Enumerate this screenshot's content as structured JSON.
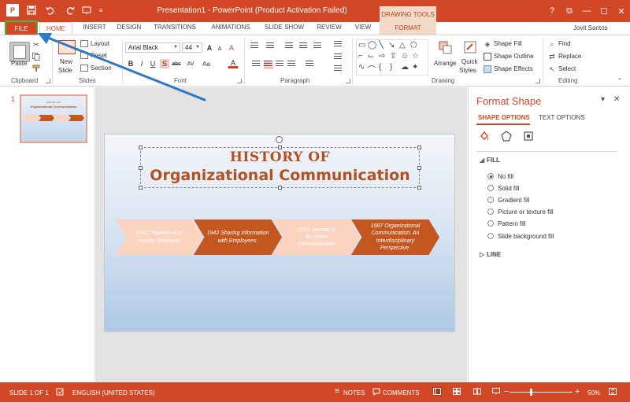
{
  "titlebar": {
    "app_icon": "P",
    "title": "Presentation1 - PowerPoint (Product Activation Failed)",
    "contextual_group": "DRAWING TOOLS",
    "qa_more": "≡",
    "window_controls": [
      "?",
      "⧉",
      "—",
      "☐",
      "✕"
    ]
  },
  "tabs": {
    "file": "FILE",
    "items": [
      "HOME",
      "INSERT",
      "DESIGN",
      "TRANSITIONS",
      "ANIMATIONS",
      "SLIDE SHOW",
      "REVIEW",
      "VIEW",
      "FORMAT"
    ],
    "user": "Jovit Santos"
  },
  "ribbon": {
    "clipboard": {
      "paste": "Paste",
      "label": "Clipboard"
    },
    "slides": {
      "new_slide": "New",
      "new_slide2": "Slide",
      "layout": "Layout",
      "reset": "Reset",
      "section": "Section",
      "label": "Slides"
    },
    "font": {
      "font_name": "Arial Black",
      "font_size": "44",
      "label": "Font",
      "bold": "B",
      "italic": "I",
      "underline": "U",
      "shadow": "S",
      "strike": "abc",
      "spacing": "AV",
      "case": "Aa",
      "color": "A",
      "grow": "A",
      "shrink": "A",
      "clear": "A"
    },
    "paragraph": {
      "label": "Paragraph"
    },
    "drawing": {
      "arrange": "Arrange",
      "quick": "Quick",
      "styles": "Styles",
      "shape_fill": "Shape Fill",
      "shape_outline": "Shape Outline",
      "shape_effects": "Shape Effects",
      "label": "Drawing"
    },
    "editing": {
      "find": "Find",
      "replace": "Replace",
      "select": "Select",
      "label": "Editing"
    }
  },
  "thumbnail": {
    "number": "1",
    "title1": "HISTORY OF",
    "title2": "Organizational Communication"
  },
  "slide": {
    "title1": "HISTORY OF",
    "title2": "Organizational Communication",
    "chevrons": [
      "1937 \"Speech and Human Relations",
      "1942 Sharing Information with Employees.",
      "1963 Journal of Business Communication",
      "1987 Organizational Communication: An Interdisciplinary Perspective."
    ]
  },
  "format_pane": {
    "title": "Format Shape",
    "tab_shape": "SHAPE OPTIONS",
    "tab_text": "TEXT OPTIONS",
    "fill_section": "FILL",
    "fill_options": [
      "No fill",
      "Solid fill",
      "Gradient fill",
      "Picture or texture fill",
      "Pattern fill",
      "Slide background fill"
    ],
    "fill_selected": "No fill",
    "line_section": "LINE"
  },
  "statusbar": {
    "slide_info": "SLIDE 1 OF 1",
    "language": "ENGLISH (UNITED STATES)",
    "notes": "NOTES",
    "comments": "COMMENTS",
    "zoom": "50%",
    "zoom_minus": "−",
    "zoom_plus": "+"
  },
  "colors": {
    "accent": "#d24726",
    "title_text": "#b25223",
    "chevron_dark": "#c4561f",
    "chevron_light": "#fbd3bf",
    "highlight_box": "#4caf3c",
    "annotation_arrow": "#2b79c7"
  },
  "icons": {
    "save": "save-icon",
    "undo": "undo-icon",
    "redo": "redo-icon",
    "start": "start-from-beginning-icon",
    "fill_line": "fill-line-icon",
    "effects": "effects-pentagon-icon",
    "size": "size-properties-icon"
  }
}
